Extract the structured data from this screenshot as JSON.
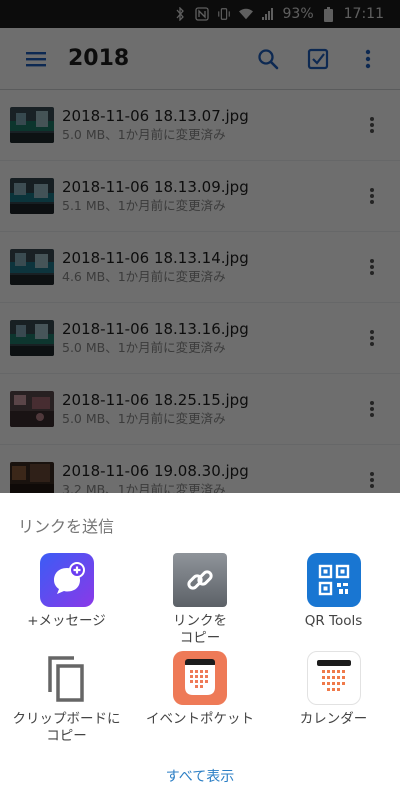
{
  "status_bar": {
    "battery": "93%",
    "time": "17:11",
    "icons": [
      "bluetooth-icon",
      "nfc-icon",
      "vibrate-icon",
      "wifi-icon",
      "signal-icon",
      "battery-icon"
    ]
  },
  "app_bar": {
    "title": "2018",
    "icons": [
      "menu-icon",
      "search-icon",
      "select-icon",
      "more-vert-icon"
    ]
  },
  "files": [
    {
      "name": "2018-11-06 18.13.07.jpg",
      "meta": "5.0 MB、1か月前に変更済み"
    },
    {
      "name": "2018-11-06 18.13.09.jpg",
      "meta": "5.1 MB、1か月前に変更済み"
    },
    {
      "name": "2018-11-06 18.13.14.jpg",
      "meta": "4.6 MB、1か月前に変更済み"
    },
    {
      "name": "2018-11-06 18.13.16.jpg",
      "meta": "5.0 MB、1か月前に変更済み"
    },
    {
      "name": "2018-11-06 18.25.15.jpg",
      "meta": "5.0 MB、1か月前に変更済み"
    },
    {
      "name": "2018-11-06 19.08.30.jpg",
      "meta": "3.2 MB、1か月前に変更済み"
    }
  ],
  "share_sheet": {
    "title": "リンクを送信",
    "items": [
      {
        "label": "+メッセージ",
        "icon": "plus-message-icon"
      },
      {
        "label": "リンクを\nコピー",
        "icon": "link-icon"
      },
      {
        "label": "QR Tools",
        "icon": "qr-code-icon"
      },
      {
        "label": "クリップボードに\nコピー",
        "icon": "clipboard-copy-icon"
      },
      {
        "label": "イベントポケット",
        "icon": "event-pocket-icon"
      },
      {
        "label": "カレンダー",
        "icon": "calendar-icon"
      }
    ],
    "show_all": "すべて表示"
  },
  "colors": {
    "accent_blue": "#1f5fbf",
    "link_blue": "#2c7fc5",
    "message_purple": "#6a3cf0",
    "qr_blue": "#1976d2",
    "event_orange": "#ee7a57",
    "calendar_orange": "#f07a4a"
  }
}
